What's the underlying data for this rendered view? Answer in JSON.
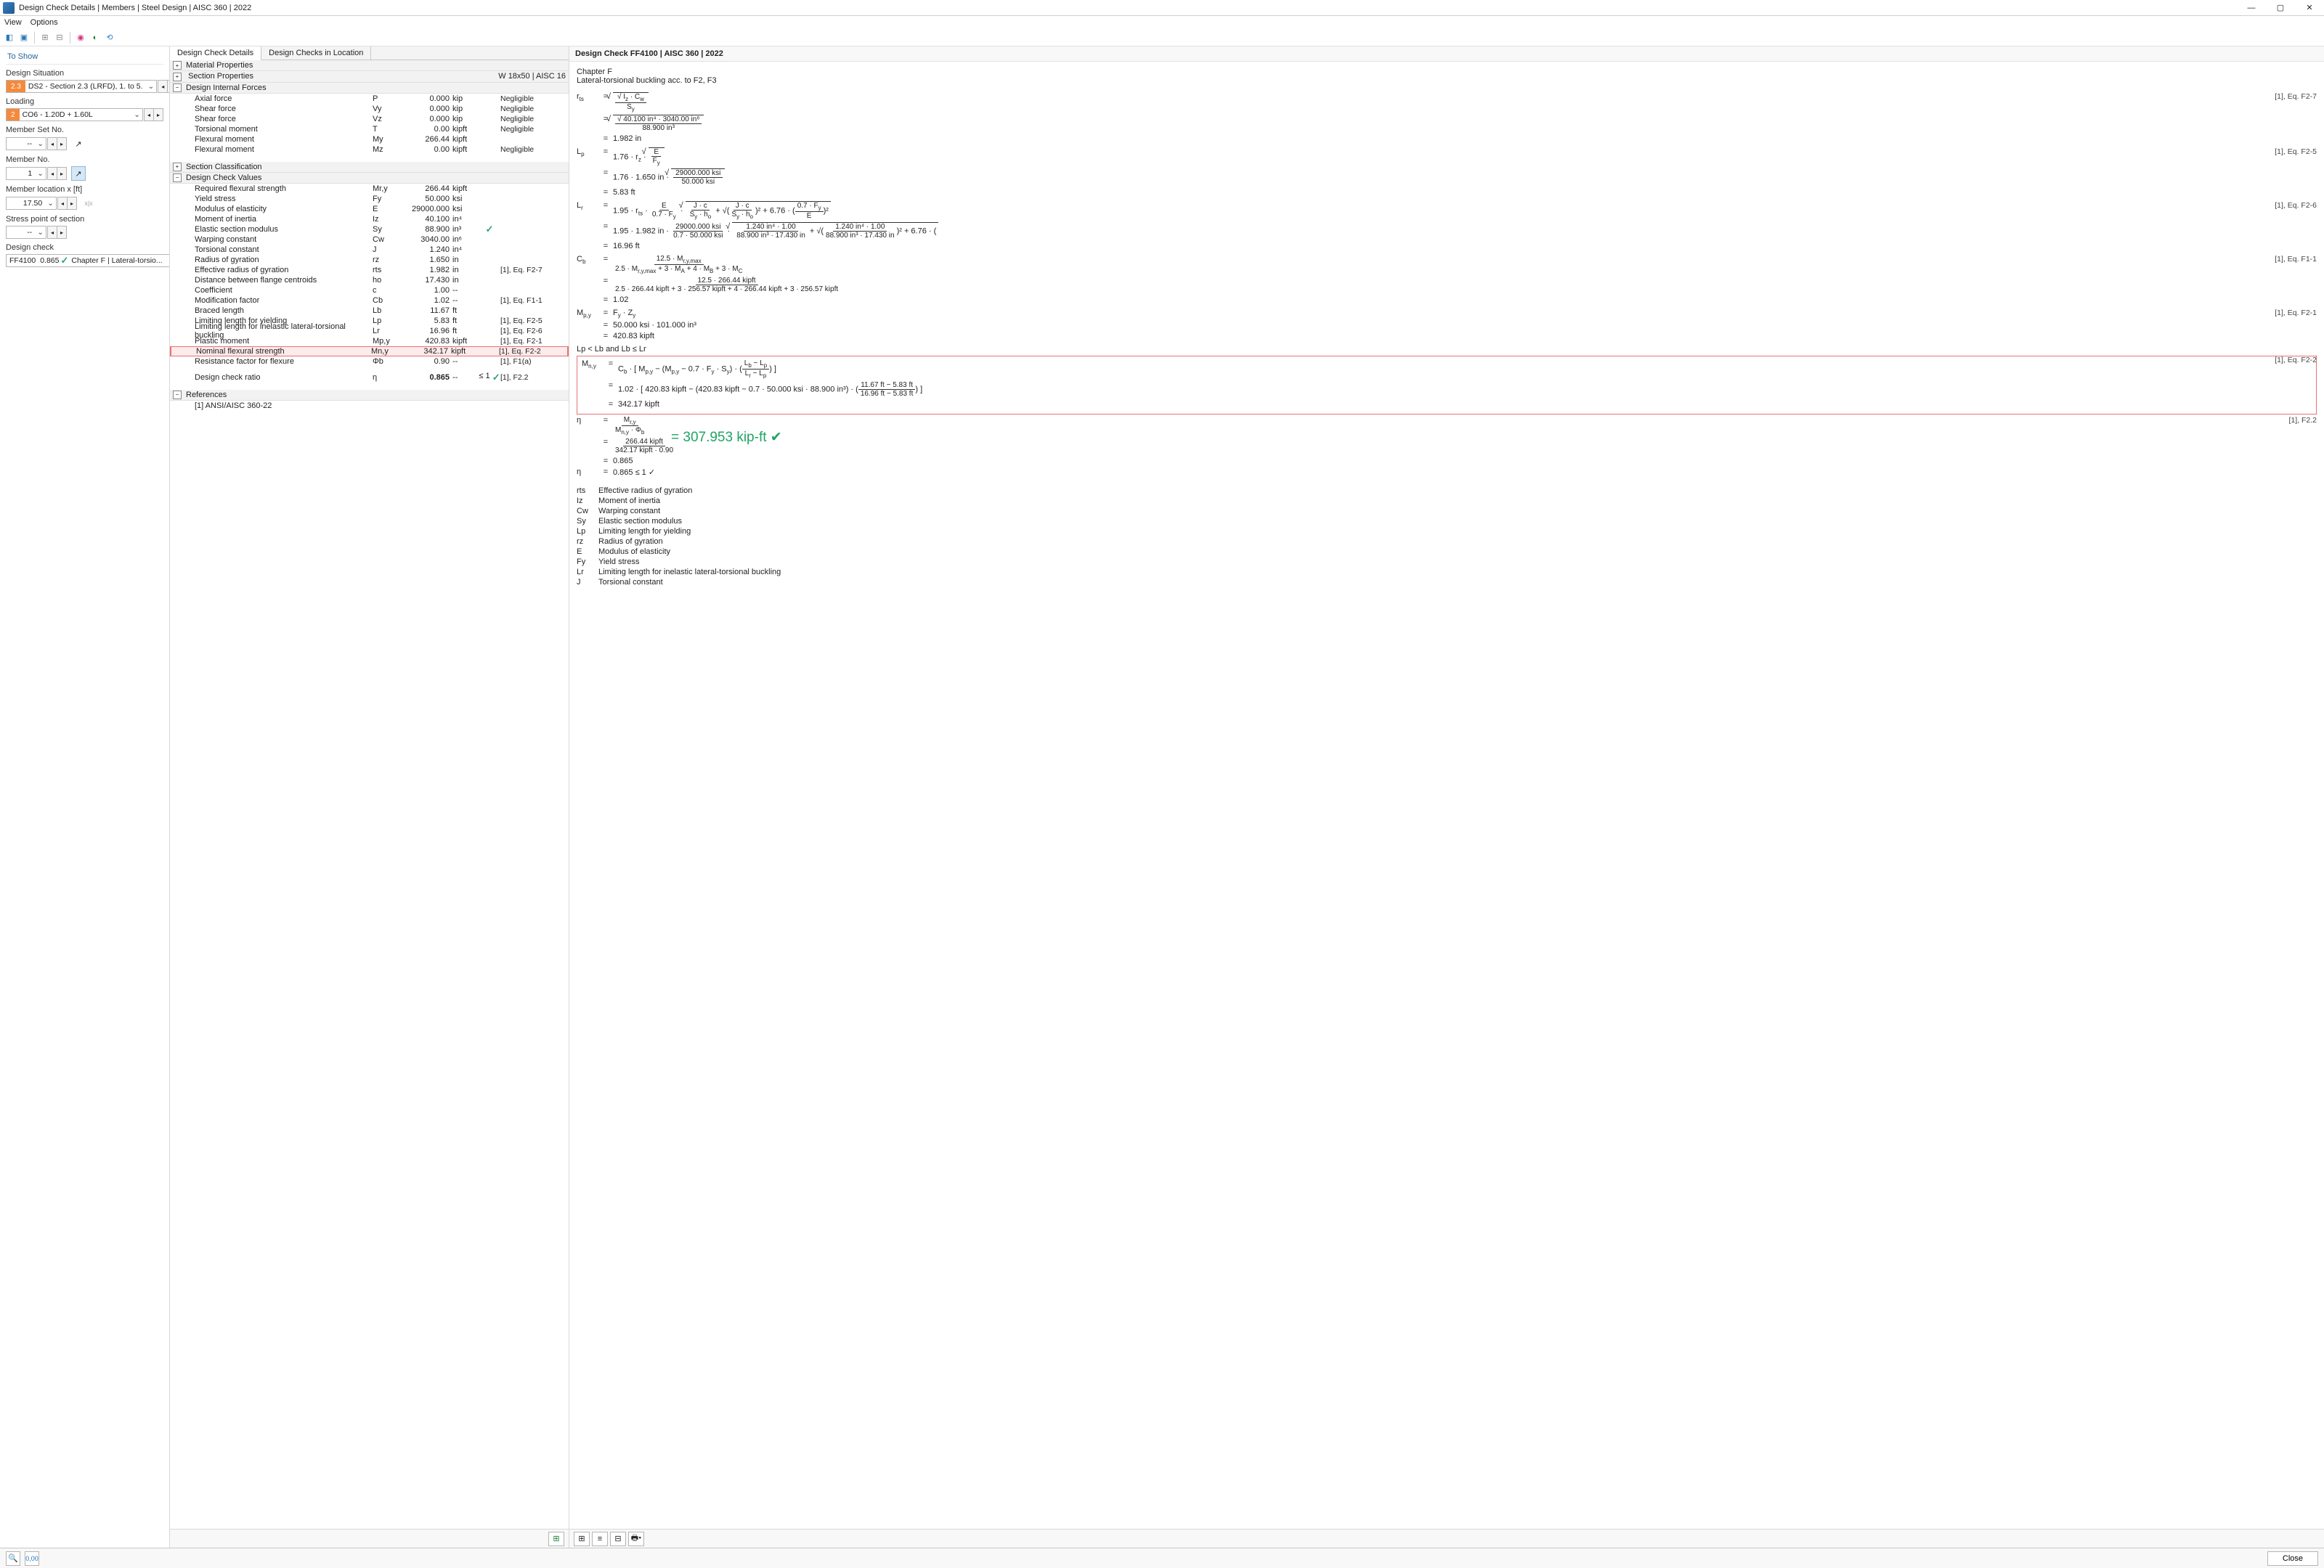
{
  "title": "Design Check Details | Members | Steel Design | AISC 360 | 2022",
  "menu": {
    "view": "View",
    "options": "Options"
  },
  "left": {
    "to_show": "To Show",
    "design_situation": "Design Situation",
    "ds_badge": "2.3",
    "ds_text": "DS2 - Section 2.3 (LRFD), 1. to 5.",
    "loading": "Loading",
    "load_badge": "2",
    "load_text": "CO6 - 1.20D + 1.60L",
    "memberset": "Member Set No.",
    "memberset_val": "--",
    "memberno": "Member No.",
    "memberno_val": "1",
    "memberloc": "Member location x [ft]",
    "memberloc_val": "17.50",
    "stresspt": "Stress point of section",
    "stresspt_val": "--",
    "designcheck": "Design check",
    "dc_id": "FF4100",
    "dc_ratio": "0.865",
    "dc_text": "Chapter F | Lateral-torsio..."
  },
  "tabs": {
    "t1": "Design Check Details",
    "t2": "Design Checks in Location"
  },
  "sections": {
    "matprops": "Material Properties",
    "secprops": "Section Properties",
    "secprops_right": "W 18x50 | AISC 16",
    "dif": "Design Internal Forces",
    "secclass": "Section Classification",
    "dcv": "Design Check Values",
    "refs": "References",
    "ref1": "[1]   ANSI/AISC 360-22"
  },
  "dif_rows": [
    {
      "n": "Axial force",
      "s": "P",
      "v": "0.000",
      "u": "kip",
      "r": "Negligible"
    },
    {
      "n": "Shear force",
      "s": "Vy",
      "sub": "y",
      "v": "0.000",
      "u": "kip",
      "r": "Negligible"
    },
    {
      "n": "Shear force",
      "s": "Vz",
      "sub": "z",
      "v": "0.000",
      "u": "kip",
      "r": "Negligible"
    },
    {
      "n": "Torsional moment",
      "s": "T",
      "v": "0.00",
      "u": "kipft",
      "r": "Negligible"
    },
    {
      "n": "Flexural moment",
      "s": "My",
      "sub": "y",
      "v": "266.44",
      "u": "kipft",
      "r": ""
    },
    {
      "n": "Flexural moment",
      "s": "Mz",
      "sub": "z",
      "v": "0.00",
      "u": "kipft",
      "r": "Negligible"
    }
  ],
  "dcv_rows": [
    {
      "n": "Required flexural strength",
      "s": "Mr,y",
      "v": "266.44",
      "u": "kipft",
      "r": ""
    },
    {
      "n": "Yield stress",
      "s": "Fy",
      "v": "50.000",
      "u": "ksi",
      "r": ""
    },
    {
      "n": "Modulus of elasticity",
      "s": "E",
      "v": "29000.000",
      "u": "ksi",
      "r": ""
    },
    {
      "n": "Moment of inertia",
      "s": "Iz",
      "v": "40.100",
      "u": "in⁴",
      "r": ""
    },
    {
      "n": "Elastic section modulus",
      "s": "Sy",
      "v": "88.900",
      "u": "in³",
      "r": "",
      "check": true
    },
    {
      "n": "Warping constant",
      "s": "Cw",
      "v": "3040.00",
      "u": "in⁶",
      "r": ""
    },
    {
      "n": "Torsional constant",
      "s": "J",
      "v": "1.240",
      "u": "in⁴",
      "r": ""
    },
    {
      "n": "Radius of gyration",
      "s": "rz",
      "v": "1.650",
      "u": "in",
      "r": ""
    },
    {
      "n": "Effective radius of gyration",
      "s": "rts",
      "v": "1.982",
      "u": "in",
      "r": "[1], Eq. F2-7"
    },
    {
      "n": "Distance between flange centroids",
      "s": "ho",
      "v": "17.430",
      "u": "in",
      "r": ""
    },
    {
      "n": "Coefficient",
      "s": "c",
      "v": "1.00",
      "u": "--",
      "r": ""
    },
    {
      "n": "Modification factor",
      "s": "Cb",
      "v": "1.02",
      "u": "--",
      "r": "[1], Eq. F1-1"
    },
    {
      "n": "Braced length",
      "s": "Lb",
      "v": "11.67",
      "u": "ft",
      "r": ""
    },
    {
      "n": "Limiting length for yielding",
      "s": "Lp",
      "v": "5.83",
      "u": "ft",
      "r": "[1], Eq. F2-5"
    },
    {
      "n": "Limiting length for inelastic lateral-torsional buckling",
      "s": "Lr",
      "v": "16.96",
      "u": "ft",
      "r": "[1], Eq. F2-6"
    },
    {
      "n": "Plastic moment",
      "s": "Mp,y",
      "v": "420.83",
      "u": "kipft",
      "r": "[1], Eq. F2-1"
    },
    {
      "n": "Nominal flexural strength",
      "s": "Mn,y",
      "v": "342.17",
      "u": "kipft",
      "r": "[1], Eq. F2-2",
      "hl": true
    },
    {
      "n": "Resistance factor for flexure",
      "s": "Φb",
      "v": "0.90",
      "u": "--",
      "r": "[1], F1(a)"
    }
  ],
  "ratio_row": {
    "n": "Design check ratio",
    "s": "η",
    "v": "0.865",
    "u": "--",
    "lim": "≤ 1",
    "r": "[1], F2.2"
  },
  "right": {
    "title": "Design Check FF4100 | AISC 360 | 2022",
    "chapter": "Chapter F",
    "desc": "Lateral-torsional buckling acc. to F2, F3",
    "refs": {
      "f27": "[1], Eq. F2-7",
      "f25": "[1], Eq. F2-5",
      "f26": "[1], Eq. F2-6",
      "f11": "[1], Eq. F1-1",
      "f21": "[1], Eq. F2-1",
      "f22": "[1], Eq. F2-2",
      "f22b": "[1], F2.2"
    },
    "vals": {
      "rts_num": "40.100 in⁴  ·  3040.00 in⁶",
      "rts_den": "88.900 in³",
      "rts": "1.982 in",
      "lp_expr": "1.76  ·  1.650 in  ·",
      "lp_frac_n": "29000.000 ksi",
      "lp_frac_d": "50.000 ksi",
      "lp": "5.83 ft",
      "lr_pre": "1.95  ·  1.982 in  ·",
      "lr_f1n": "29000.000 ksi",
      "lr_f1d": "0.7  ·  50.000 ksi",
      "lr_f2n": "1.240 in⁴  ·  1.00",
      "lr_f2d": "88.900 in³  ·  17.430 in",
      "lr": "16.96 ft",
      "cb_num": "12.5  ·  266.44 kipft",
      "cb_den": "2.5  ·  266.44 kipft  +  3  ·  256.57 kipft  +  4  ·  266.44 kipft  +  3  ·  256.57 kipft",
      "cb": "1.02",
      "mpy_expr": "50.000 ksi  ·  101.000 in³",
      "mpy": "420.83 kipft",
      "cond": "Lp  <  Lb  and  Lb  ≤  Lr",
      "mny_expr": "1.02  ·  [ 420.83 kipft  −  (420.83 kipft  −  0.7  ·  50.000 ksi  ·  88.900 in³)  ·",
      "mny_fn": "11.67 ft  −  5.83 ft",
      "mny_fd": "16.96 ft  −  5.83 ft",
      "mny": "342.17 kipft",
      "eta_n": "266.44 kipft",
      "eta_d": "342.17 kipft  ·  0.90",
      "eta": "0.865",
      "eta_final": "0.865  ≤ 1 ✓"
    },
    "annotation": "= 307.953 kip-ft ✔",
    "glossary": [
      {
        "s": "rts",
        "d": "Effective radius of gyration"
      },
      {
        "s": "Iz",
        "d": "Moment of inertia"
      },
      {
        "s": "Cw",
        "d": "Warping constant"
      },
      {
        "s": "Sy",
        "d": "Elastic section modulus"
      },
      {
        "s": "Lp",
        "d": "Limiting length for yielding"
      },
      {
        "s": "rz",
        "d": "Radius of gyration"
      },
      {
        "s": "E",
        "d": "Modulus of elasticity"
      },
      {
        "s": "Fy",
        "d": "Yield stress"
      },
      {
        "s": "Lr",
        "d": "Limiting length for inelastic lateral-torsional buckling"
      },
      {
        "s": "J",
        "d": "Torsional constant"
      }
    ]
  },
  "footer": {
    "close": "Close"
  }
}
